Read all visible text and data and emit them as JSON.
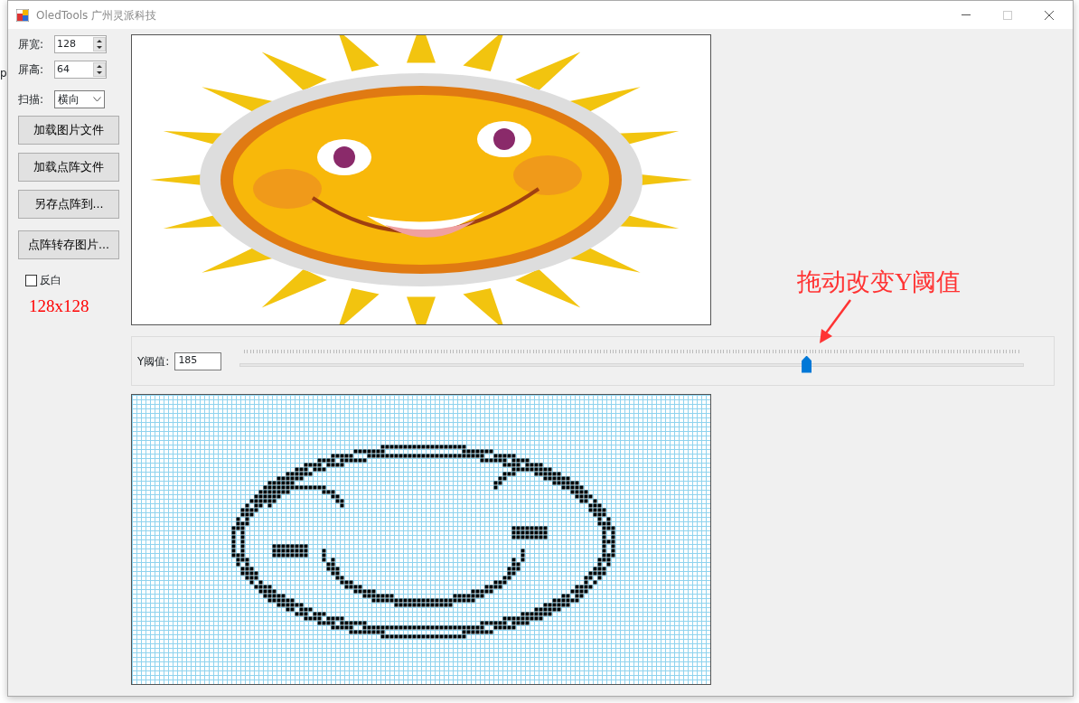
{
  "background_fragment": "p",
  "window": {
    "title": "OledTools 广州灵派科技"
  },
  "settings": [
    {
      "kind": "spin",
      "label": "屏宽:",
      "value": "128"
    },
    {
      "kind": "spin",
      "label": "屏高:",
      "value": "64"
    },
    {
      "kind": "select",
      "label": "扫描:",
      "value": "横向"
    }
  ],
  "buttons": [
    "加载图片文件",
    "加载点阵文件",
    "另存点阵到...",
    "点阵转存图片..."
  ],
  "invert": {
    "label": "反白",
    "checked": false
  },
  "size_label": "128x128",
  "annotation": "拖动改变Y阈值",
  "threshold": {
    "label": "Y阈值:",
    "value": "185",
    "level": 0.722
  }
}
